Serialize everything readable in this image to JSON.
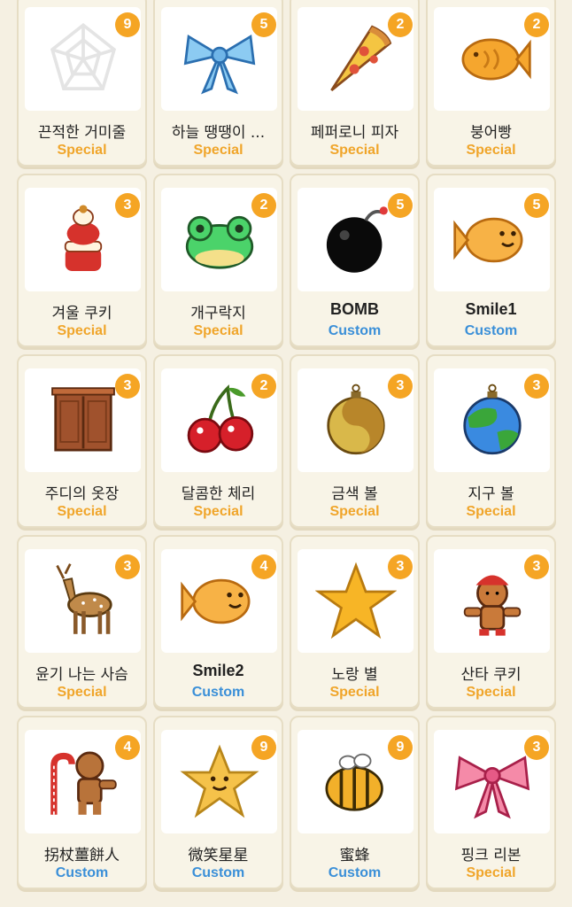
{
  "colors": {
    "special": "#f0a52a",
    "custom": "#3a8fd8",
    "badge": "#f5a524"
  },
  "items": [
    {
      "name": "끈적한 거미줄",
      "type": "Special",
      "count": "9",
      "icon": "spider-web-icon"
    },
    {
      "name": "하늘 땡땡이 ...",
      "type": "Special",
      "count": "5",
      "icon": "blue-ribbon-icon"
    },
    {
      "name": "페퍼로니 피자",
      "type": "Special",
      "count": "2",
      "icon": "pizza-icon"
    },
    {
      "name": "붕어빵",
      "type": "Special",
      "count": "2",
      "icon": "fish-bread-icon"
    },
    {
      "name": "겨울 쿠키",
      "type": "Special",
      "count": "3",
      "icon": "winter-cookie-icon"
    },
    {
      "name": "개구락지",
      "type": "Special",
      "count": "2",
      "icon": "frog-icon"
    },
    {
      "name": "BOMB",
      "type": "Custom",
      "count": "5",
      "icon": "bomb-icon"
    },
    {
      "name": "Smile1",
      "type": "Custom",
      "count": "5",
      "icon": "smile-fish-icon"
    },
    {
      "name": "주디의 옷장",
      "type": "Special",
      "count": "3",
      "icon": "wardrobe-icon"
    },
    {
      "name": "달콤한 체리",
      "type": "Special",
      "count": "2",
      "icon": "cherry-icon"
    },
    {
      "name": "금색 볼",
      "type": "Special",
      "count": "3",
      "icon": "gold-ornament-icon"
    },
    {
      "name": "지구 볼",
      "type": "Special",
      "count": "3",
      "icon": "earth-ornament-icon"
    },
    {
      "name": "윤기 나는 사슴",
      "type": "Special",
      "count": "3",
      "icon": "deer-icon"
    },
    {
      "name": "Smile2",
      "type": "Custom",
      "count": "4",
      "icon": "smile-fish-icon"
    },
    {
      "name": "노랑 별",
      "type": "Special",
      "count": "3",
      "icon": "yellow-star-icon"
    },
    {
      "name": "산타 쿠키",
      "type": "Special",
      "count": "3",
      "icon": "santa-cookie-icon"
    },
    {
      "name": "拐杖薑餅人",
      "type": "Custom",
      "count": "4",
      "icon": "gingerbread-cane-icon"
    },
    {
      "name": "微笑星星",
      "type": "Custom",
      "count": "9",
      "icon": "smiling-star-icon"
    },
    {
      "name": "蜜蜂",
      "type": "Custom",
      "count": "9",
      "icon": "bee-icon"
    },
    {
      "name": "핑크 리본",
      "type": "Special",
      "count": "3",
      "icon": "pink-ribbon-icon"
    }
  ]
}
